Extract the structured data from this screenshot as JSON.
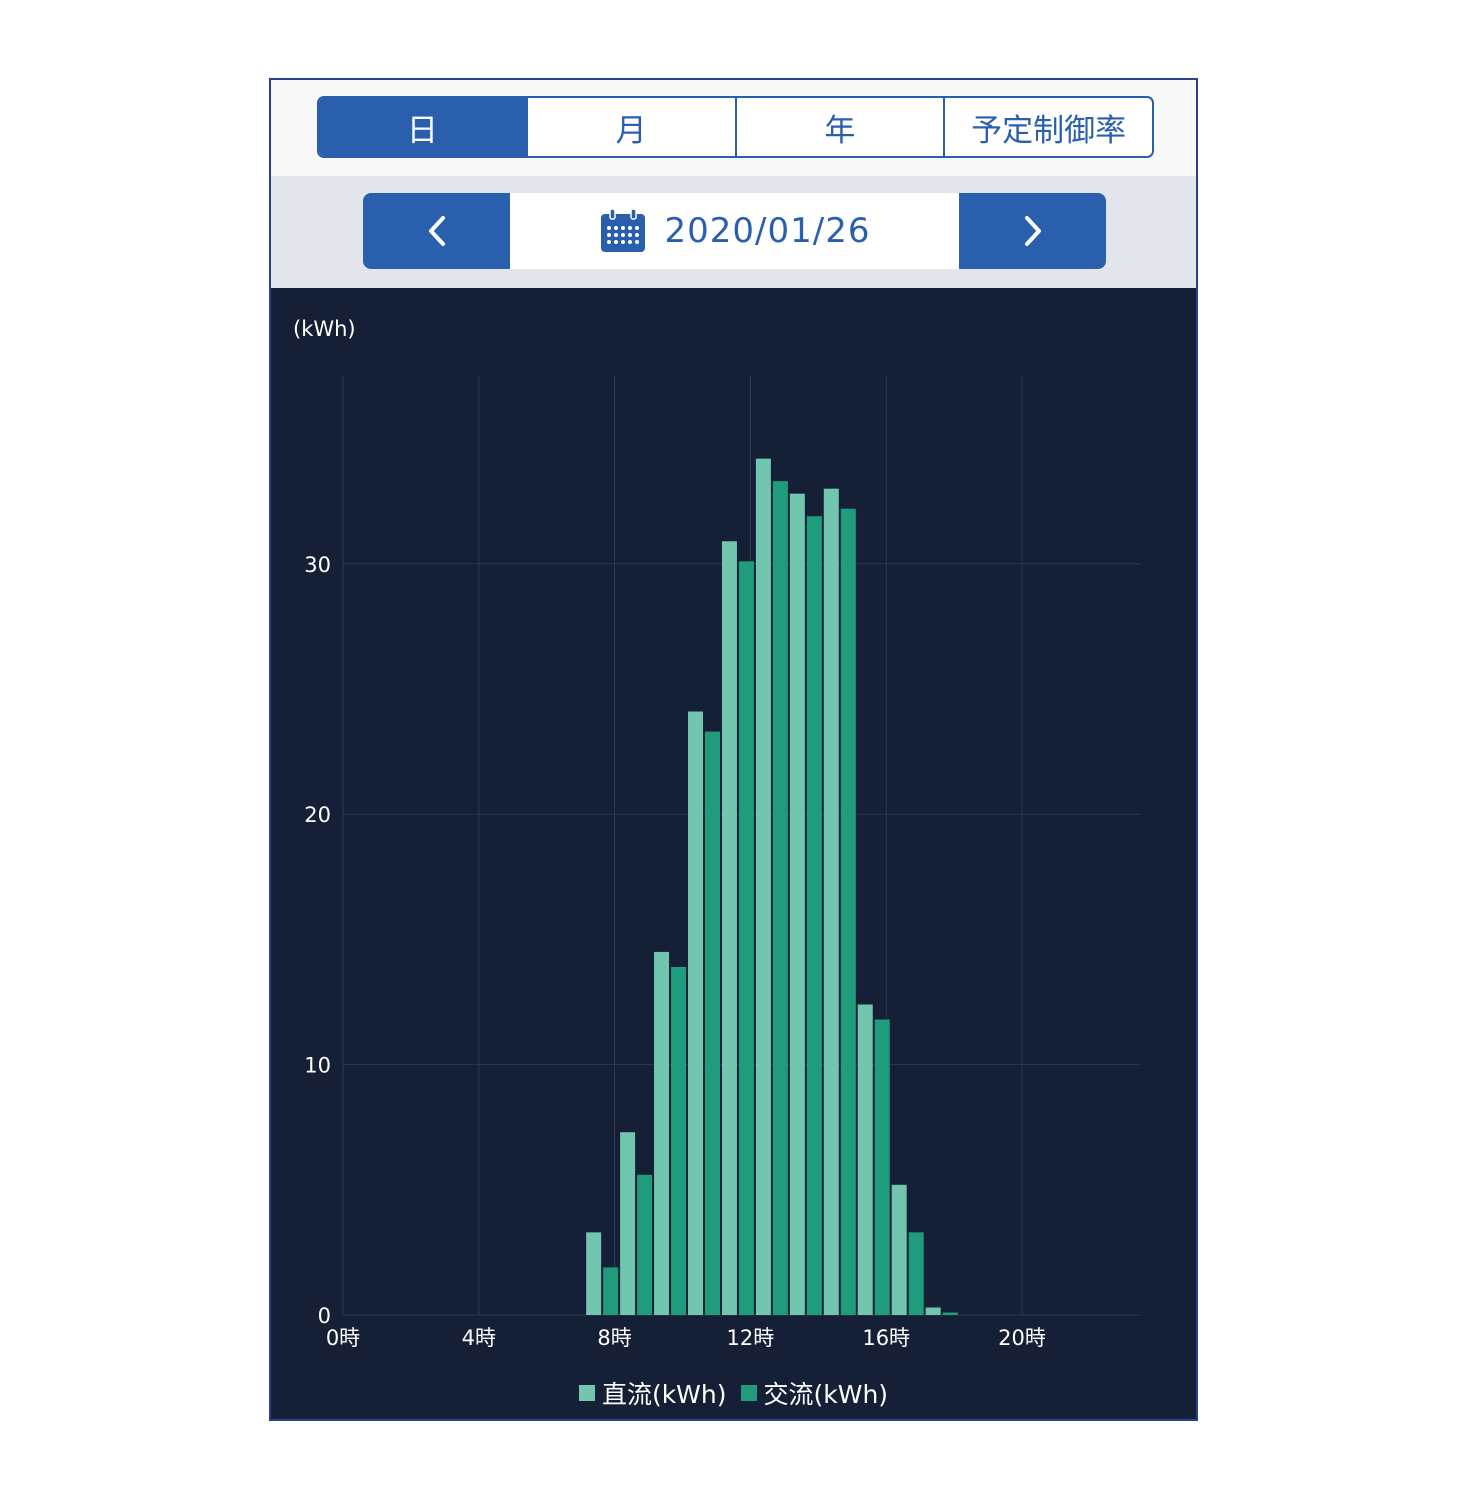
{
  "tabs": [
    {
      "label": "日",
      "active": true
    },
    {
      "label": "月",
      "active": false
    },
    {
      "label": "年",
      "active": false
    },
    {
      "label": "予定制御率",
      "active": false
    }
  ],
  "date_nav": {
    "date": "2020/01/26",
    "prev_icon": "chevron-left-icon",
    "next_icon": "chevron-right-icon",
    "calendar_icon": "calendar-icon"
  },
  "colors": {
    "accent": "#2a5fae",
    "chart_bg": "#152036",
    "dc": "#72c6b0",
    "ac": "#1f9c7c"
  },
  "chart_data": {
    "type": "bar",
    "ylabel": "(kWh)",
    "xlabel": "",
    "ylim": [
      0,
      37.5
    ],
    "yticks": [
      0,
      10,
      20,
      30
    ],
    "x_tick_hours": [
      0,
      4,
      8,
      12,
      16,
      20
    ],
    "x_tick_labels": [
      "0時",
      "4時",
      "8時",
      "12時",
      "16時",
      "20時"
    ],
    "grid": true,
    "legend_position": "bottom-center",
    "categories": [
      0,
      1,
      2,
      3,
      4,
      5,
      6,
      7,
      8,
      9,
      10,
      11,
      12,
      13,
      14,
      15,
      16,
      17,
      18,
      19,
      20,
      21,
      22,
      23
    ],
    "series": [
      {
        "name": "直流(kWh)",
        "color": "#72c6b0",
        "values": [
          0,
          0,
          0,
          0,
          0,
          0,
          0,
          3.3,
          7.3,
          14.5,
          24.1,
          30.9,
          34.2,
          32.8,
          33.0,
          12.4,
          5.2,
          0.3,
          0,
          0,
          0,
          0,
          0,
          0
        ]
      },
      {
        "name": "交流(kWh)",
        "color": "#1f9c7c",
        "values": [
          0,
          0,
          0,
          0,
          0,
          0,
          0,
          1.9,
          5.6,
          13.9,
          23.3,
          30.1,
          33.3,
          31.9,
          32.2,
          11.8,
          3.3,
          0.1,
          0,
          0,
          0,
          0,
          0,
          0
        ]
      }
    ]
  }
}
